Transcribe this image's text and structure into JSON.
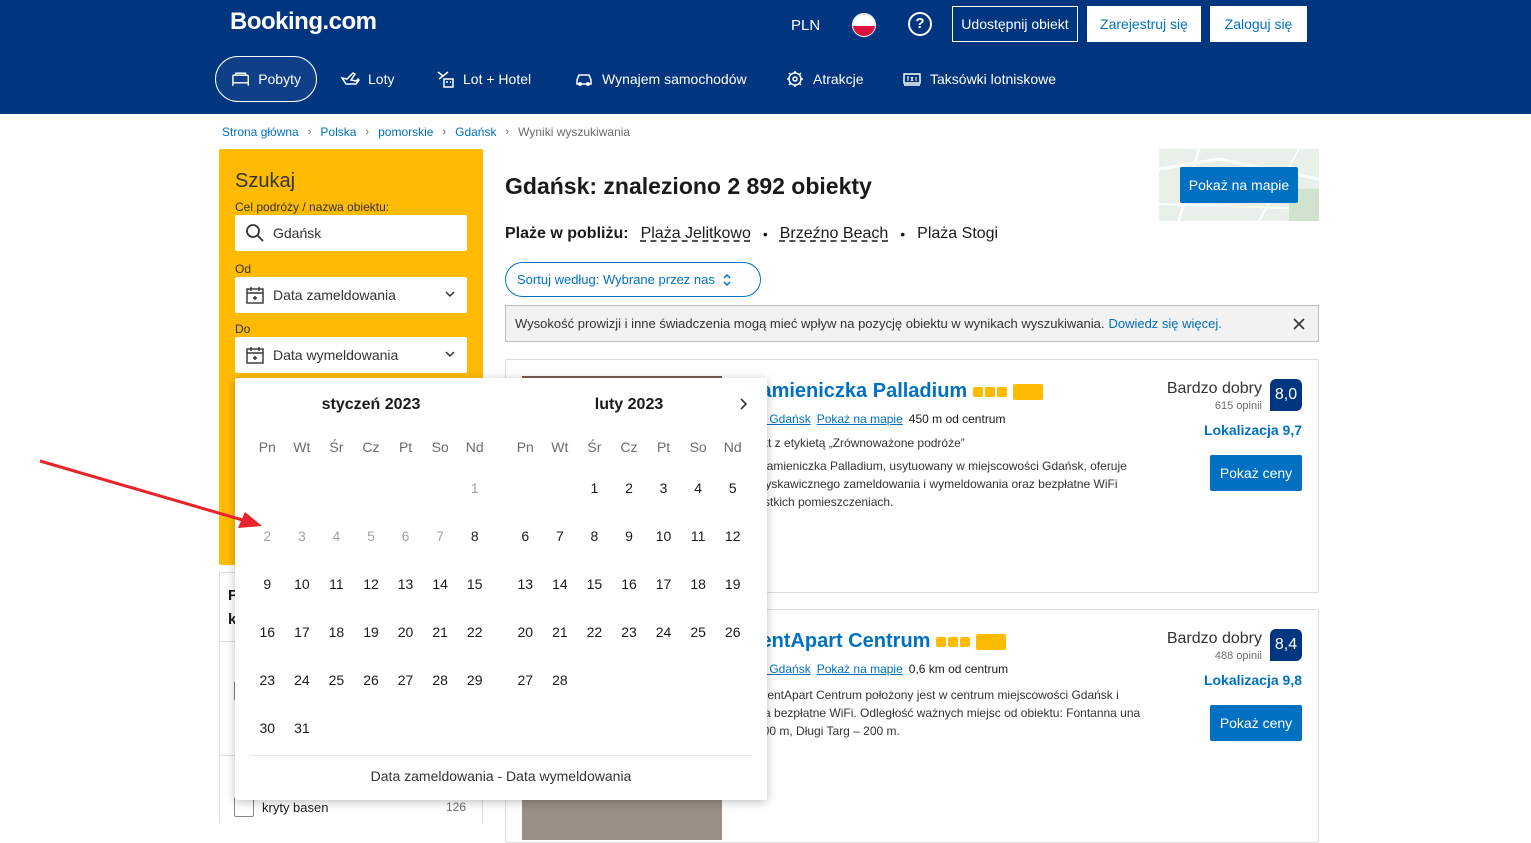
{
  "header": {
    "logo": "Booking.com",
    "currency": "PLN",
    "help_icon": "?",
    "list_property": "Udostępnij obiekt",
    "register": "Zarejestruj się",
    "login": "Zaloguj się",
    "nav": [
      {
        "label": "Pobyty",
        "icon": "bed-icon",
        "active": true
      },
      {
        "label": "Loty",
        "icon": "plane-icon"
      },
      {
        "label": "Lot + Hotel",
        "icon": "plane-hotel-icon"
      },
      {
        "label": "Wynajem samochodów",
        "icon": "car-icon"
      },
      {
        "label": "Atrakcje",
        "icon": "attractions-icon"
      },
      {
        "label": "Taksówki lotniskowe",
        "icon": "taxi-icon"
      }
    ]
  },
  "breadcrumb": [
    "Strona główna",
    "Polska",
    "pomorskie",
    "Gdańsk",
    "Wyniki wyszukiwania"
  ],
  "search": {
    "title": "Szukaj",
    "dest_label": "Cel podróży / nazwa obiektu:",
    "dest_value": "Gdańsk",
    "from_label": "Od",
    "checkin": "Data zameldowania",
    "to_label": "Do",
    "checkout": "Data wymeldowania"
  },
  "filters": {
    "heading_1": "F",
    "heading_2": "k",
    "item_label": "kryty basen",
    "item_count": "126"
  },
  "results": {
    "title": "Gdańsk: znaleziono 2 892 obiekty",
    "beaches_label": "Plaże w pobliżu:",
    "beaches": [
      "Plaża Jelitkowo",
      "Brzeźno Beach",
      "Plaża Stogi"
    ],
    "sort": "Sortuj według: Wybrane przez nas",
    "notice": "Wysokość prowizji i inne świadczenia mogą mieć wpływ na pozycję obiektu w wynikach wyszukiwania.",
    "notice_link": "Dowiedz się więcej.",
    "map_button": "Pokaż na mapie"
  },
  "hotels": [
    {
      "name": "Kamieniczka Palladium",
      "loc_link": "um, Gdańsk",
      "map_link": "Pokaż na mapie",
      "distance": "450 m od centrum",
      "tag": "biekt z etykietą „Zrównoważone podróże”",
      "desc": "ct Kamieniczka Palladium, usytuowany w miejscowości Gdańsk, oferuje\nę błyskawicznego zameldowania i wymeldowania oraz bezpłatne WiFi\nszystkich pomieszczeniach.",
      "rating_label": "Bardzo dobry",
      "reviews": "615 opinii",
      "score": "8,0",
      "location_score": "Lokalizacja 9,7",
      "button": "Pokaż ceny"
    },
    {
      "name": "RentApart Centrum",
      "loc_link": "um, Gdańsk",
      "map_link": "Pokaż na mapie",
      "distance": "0,6 km od centrum",
      "tag": "",
      "desc": "ct RentApart Centrum położony jest w centrum miejscowości Gdańsk i\nwnia bezpłatne WiFi. Odległość ważnych miejsc od obiektu: Fontanna\nuna – 200 m, Długi Targ – 200 m.",
      "rating_label": "Bardzo dobry",
      "reviews": "488 opinii",
      "score": "8,4",
      "location_score": "Lokalizacja 9,8",
      "button": "Pokaż ceny"
    }
  ],
  "calendar": {
    "weekdays": [
      "Pn",
      "Wt",
      "Śr",
      "Cz",
      "Pt",
      "So",
      "Nd"
    ],
    "months": [
      {
        "title": "styczeń 2023",
        "offset": 6,
        "days": 31,
        "disabled_through": 7
      },
      {
        "title": "luty 2023",
        "offset": 2,
        "days": 28,
        "disabled_through": 0
      }
    ],
    "footer": "Data zameldowania - Data wymeldowania"
  },
  "colors": {
    "header": "#003580",
    "accent": "#0071c2",
    "search_bg": "#febb02",
    "arrow": "#e8232a"
  }
}
